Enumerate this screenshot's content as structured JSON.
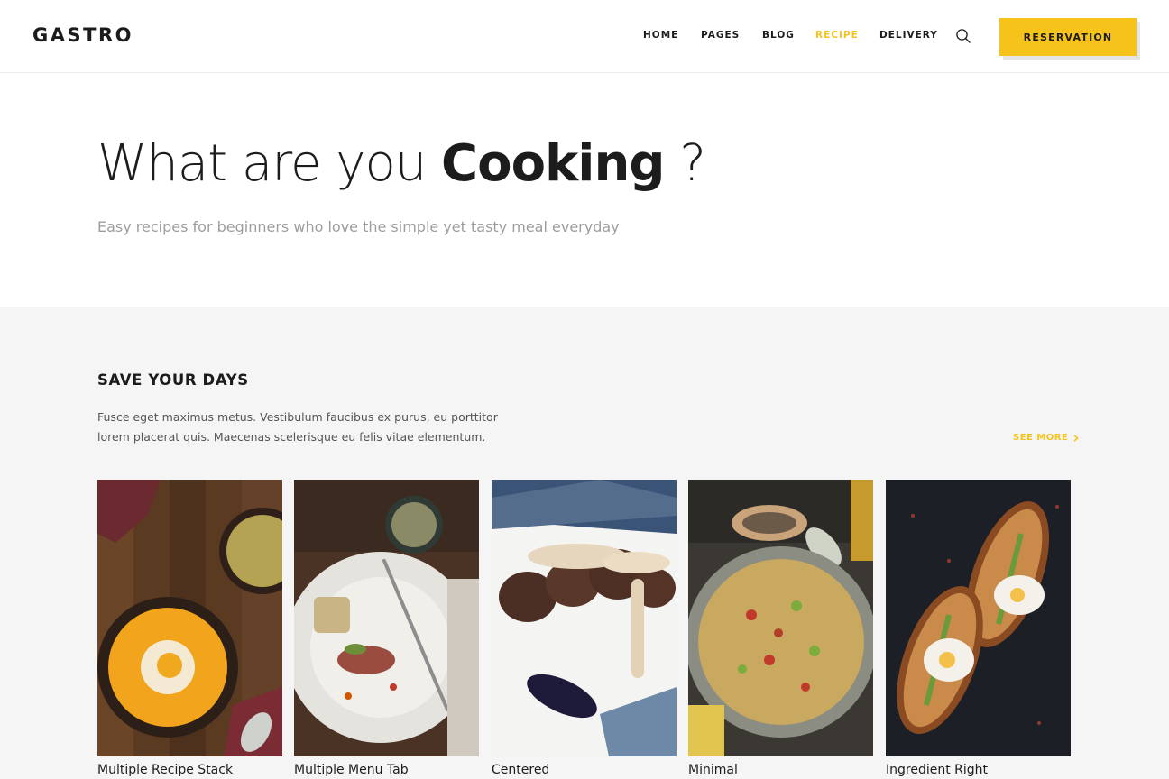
{
  "header": {
    "logo": "GASTRO",
    "nav": [
      {
        "label": "HOME",
        "active": false
      },
      {
        "label": "PAGES",
        "active": false
      },
      {
        "label": "BLOG",
        "active": false
      },
      {
        "label": "RECIPE",
        "active": true
      },
      {
        "label": "DELIVERY",
        "active": false
      }
    ],
    "search_icon": "search-icon",
    "reservation_label": "RESERVATION"
  },
  "hero": {
    "title_light": "What are you ",
    "title_bold": "Cooking",
    "title_end": " ?",
    "subtitle": "Easy recipes for beginners who love the simple yet tasty meal everyday"
  },
  "section": {
    "title": "SAVE YOUR DAYS",
    "description": "Fusce eget maximus metus. Vestibulum faucibus ex purus, eu porttitor lorem placerat quis. Maecenas scelerisque eu felis vitae elementum.",
    "see_more": "SEE MORE",
    "cards": [
      {
        "title": "Multiple Recipe Stack"
      },
      {
        "title": "Multiple Menu Tab"
      },
      {
        "title": "Centered"
      },
      {
        "title": "Minimal"
      },
      {
        "title": "Ingredient Right"
      }
    ]
  },
  "colors": {
    "accent": "#f6c31a",
    "text": "#1c1c1c",
    "muted": "#9d9d9d",
    "section_bg": "#f5f5f5"
  }
}
